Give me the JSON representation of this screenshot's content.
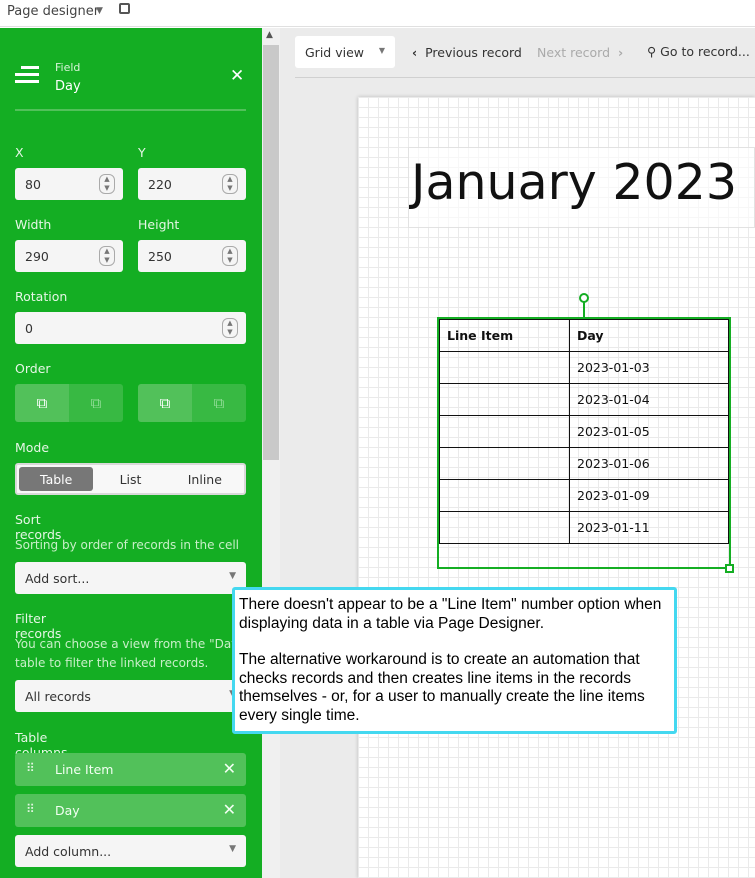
{
  "topbar": {
    "title": "Page designer",
    "dropdown_icon": "caret-down-icon",
    "external_icon": "external-link-icon"
  },
  "sidebar": {
    "header": {
      "kicker": "Field",
      "name": "Day"
    },
    "x": {
      "label": "X",
      "value": "80"
    },
    "y": {
      "label": "Y",
      "value": "220"
    },
    "width": {
      "label": "Width",
      "value": "290"
    },
    "height": {
      "label": "Height",
      "value": "250"
    },
    "rotation": {
      "label": "Rotation",
      "value": "0"
    },
    "order": {
      "label": "Order"
    },
    "mode": {
      "label": "Mode",
      "options": [
        "Table",
        "List",
        "Inline"
      ],
      "selected": "Table"
    },
    "sort": {
      "label": "Sort records",
      "description": "Sorting by order of records in the cell",
      "placeholder": "Add sort..."
    },
    "filter": {
      "label": "Filter records",
      "description_line1": "You can choose a view from the \"Day\"",
      "description_line2": "table to filter the linked records.",
      "value": "All records"
    },
    "columns": {
      "label": "Table columns",
      "items": [
        "Line Item",
        "Day"
      ],
      "add_placeholder": "Add column..."
    }
  },
  "toolbar": {
    "view": "Grid view",
    "prev": "Previous record",
    "next": "Next record",
    "goto": "Go to record..."
  },
  "canvas": {
    "title": "January 2023",
    "table": {
      "headers": [
        "Line Item",
        "Day"
      ],
      "rows": [
        [
          "",
          "2023-01-03"
        ],
        [
          "",
          "2023-01-04"
        ],
        [
          "",
          "2023-01-05"
        ],
        [
          "",
          "2023-01-06"
        ],
        [
          "",
          "2023-01-09"
        ],
        [
          "",
          "2023-01-11"
        ]
      ]
    }
  },
  "callout": {
    "p1": "There doesn't appear to be a \"Line Item\" number option when displaying data in a table via Page Designer.",
    "p2": "The alternative workaround is to create an automation that checks records and then creates line items in the records themselves - or, for a user to manually create the line items every single time."
  },
  "colors": {
    "sidebar": "#14ae23",
    "callout_border": "#44d8f0",
    "selection": "#14ae23"
  }
}
